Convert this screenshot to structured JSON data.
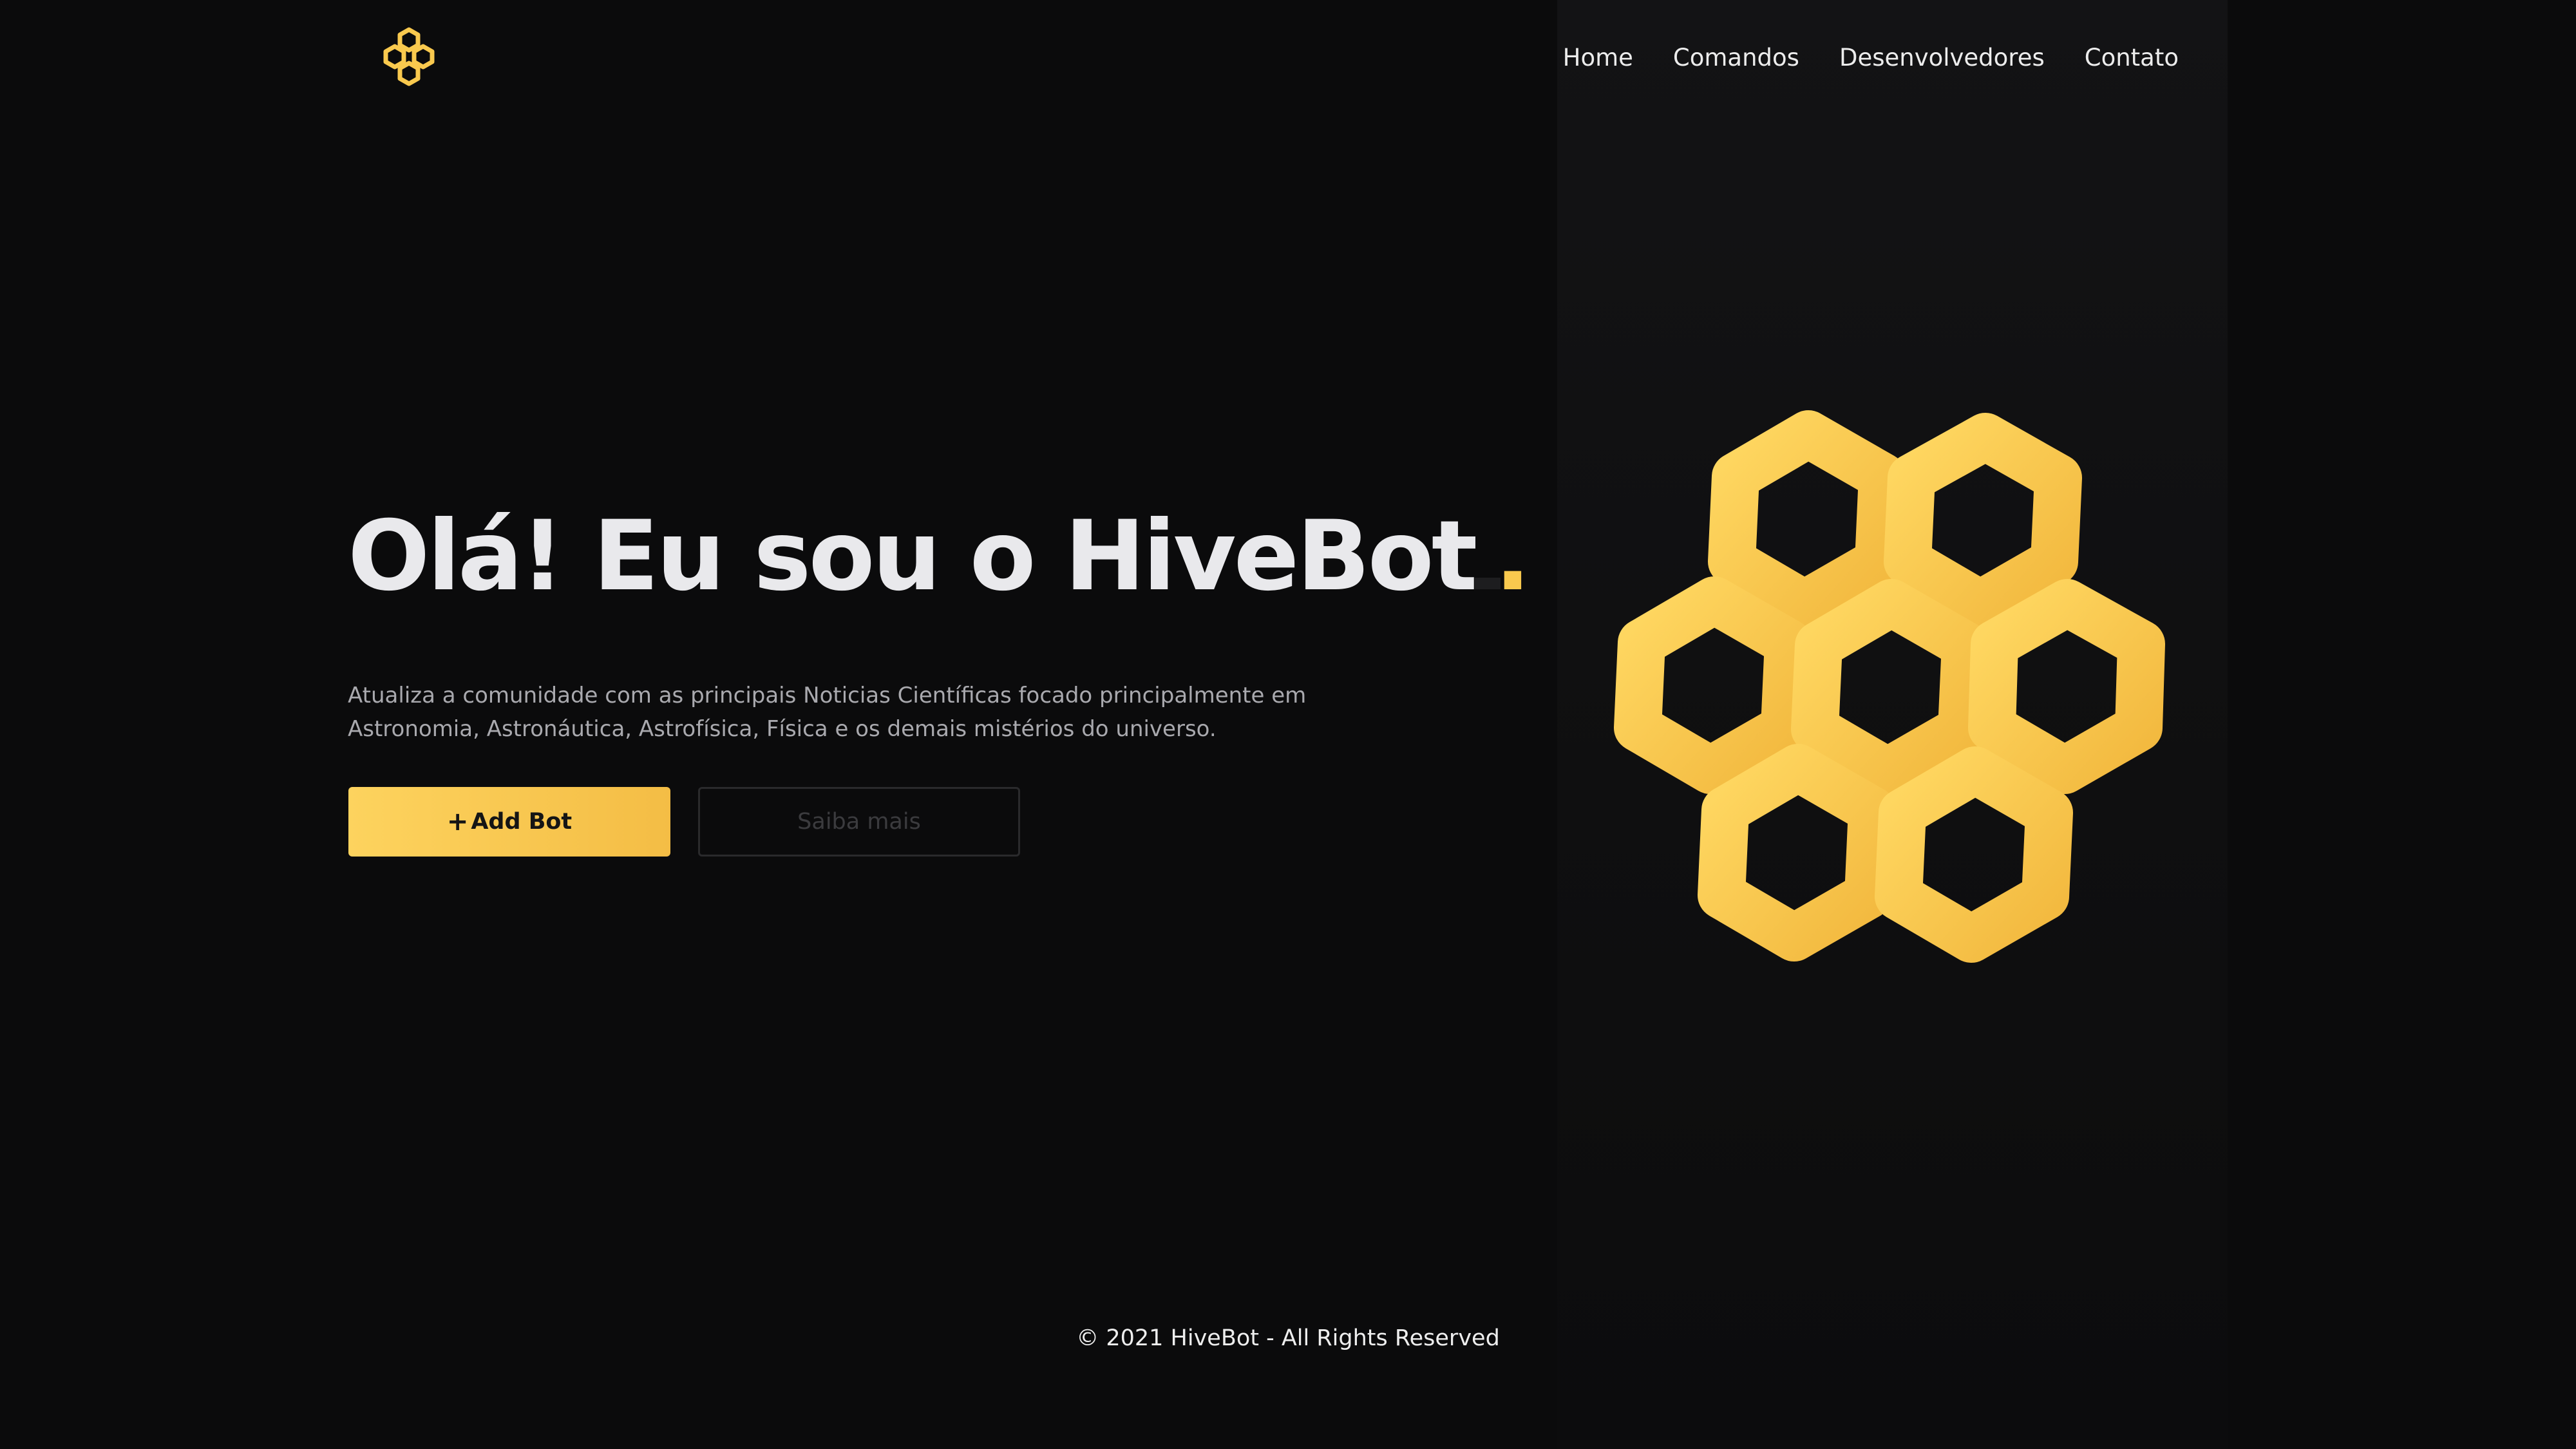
{
  "nav": {
    "items": [
      {
        "label": "Home"
      },
      {
        "label": "Comandos"
      },
      {
        "label": "Desenvolvedores"
      },
      {
        "label": "Contato"
      }
    ]
  },
  "hero": {
    "title": "Olá! Eu sou o HiveBot",
    "title_dot": ".",
    "description": "Atualiza a comunidade com as principais Noticias Científicas focado principalmente em Astronomia, Astronáutica, Astrofísica, Física e os demais mistérios do universo.",
    "add_bot_icon": "+",
    "add_bot_label": "Add Bot",
    "more_label": "Saiba mais"
  },
  "footer": {
    "text": "© 2021 HiveBot - All Rights Reserved"
  },
  "icons": {
    "logo": "honeycomb-icon",
    "hero_art": "honeycomb-icon",
    "add": "plus-icon"
  },
  "colors": {
    "background": "#0b0b0c",
    "panel": "#121214",
    "accent": "#f9c94e",
    "accent_dark": "#f4bd45",
    "text": "#e9e9ec",
    "muted": "#a9a9ae"
  }
}
